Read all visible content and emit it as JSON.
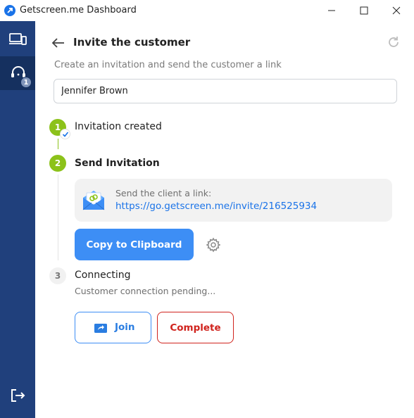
{
  "window": {
    "title": "Getscreen.me Dashboard"
  },
  "sidebar": {
    "items": [
      {
        "icon": "devices-icon"
      },
      {
        "icon": "support-headset-icon",
        "badge": "1"
      },
      {
        "icon": "logout-icon"
      }
    ]
  },
  "header": {
    "title": "Invite the customer",
    "subtitle": "Create an invitation and send the customer a link"
  },
  "form": {
    "customer_name": "Jennifer Brown"
  },
  "steps": [
    {
      "number": "1",
      "label": "Invitation created",
      "status": "done"
    },
    {
      "number": "2",
      "label": "Send Invitation",
      "status": "active"
    },
    {
      "number": "3",
      "label": "Connecting",
      "status": "pending",
      "detail": "Customer connection pending..."
    }
  ],
  "invite": {
    "caption": "Send the client a link:",
    "url": "https://go.getscreen.me/invite/216525934"
  },
  "buttons": {
    "copy": "Copy to Clipboard",
    "join": "Join",
    "complete": "Complete"
  },
  "colors": {
    "sidebar": "#20407c",
    "accent": "#3d8ef5",
    "success": "#8cc21a",
    "danger": "#d0231d"
  }
}
